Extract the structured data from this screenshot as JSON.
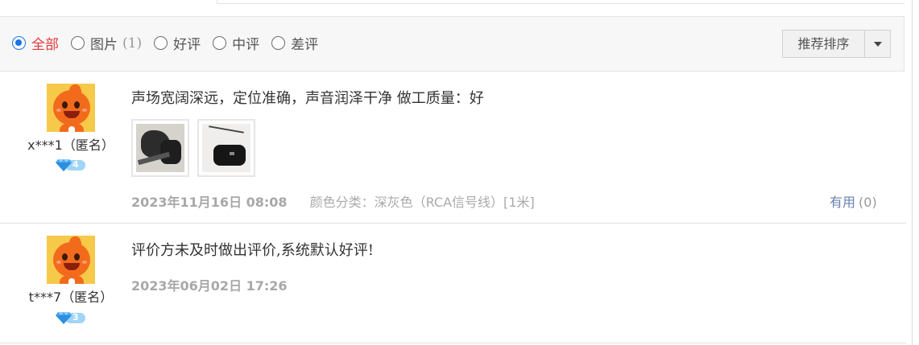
{
  "filters": {
    "options": [
      {
        "label": "全部",
        "count": "",
        "checked": true
      },
      {
        "label": "图片",
        "count": "(1)",
        "checked": false
      },
      {
        "label": "好评",
        "count": "",
        "checked": false
      },
      {
        "label": "中评",
        "count": "",
        "checked": false
      },
      {
        "label": "差评",
        "count": "",
        "checked": false
      }
    ],
    "sort_label": "推荐排序"
  },
  "reviews": [
    {
      "user": "x***1",
      "anon_label": "（匿名）",
      "level": "4",
      "text": "声场宽阔深远，定位准确，声音润泽干净 做工质量：好",
      "images": [
        "product-photo-cables",
        "product-photo-black-box"
      ],
      "date": "2023年11月16日 08:08",
      "spec": "颜色分类：深灰色（RCA信号线）[1米]",
      "useful_label": "有用",
      "useful_count": "(0)"
    },
    {
      "user": "t***7",
      "anon_label": "（匿名）",
      "level": "3",
      "text": "评价方未及时做出评价,系统默认好评!",
      "date": "2023年06月02日 17:26"
    }
  ],
  "colors": {
    "accent_red": "#e4393c",
    "radio_blue": "#1a73e8",
    "useful_link": "#6a7fb0",
    "avatar_bg": "#f6c94a",
    "avatar_orange": "#f26b1d"
  }
}
